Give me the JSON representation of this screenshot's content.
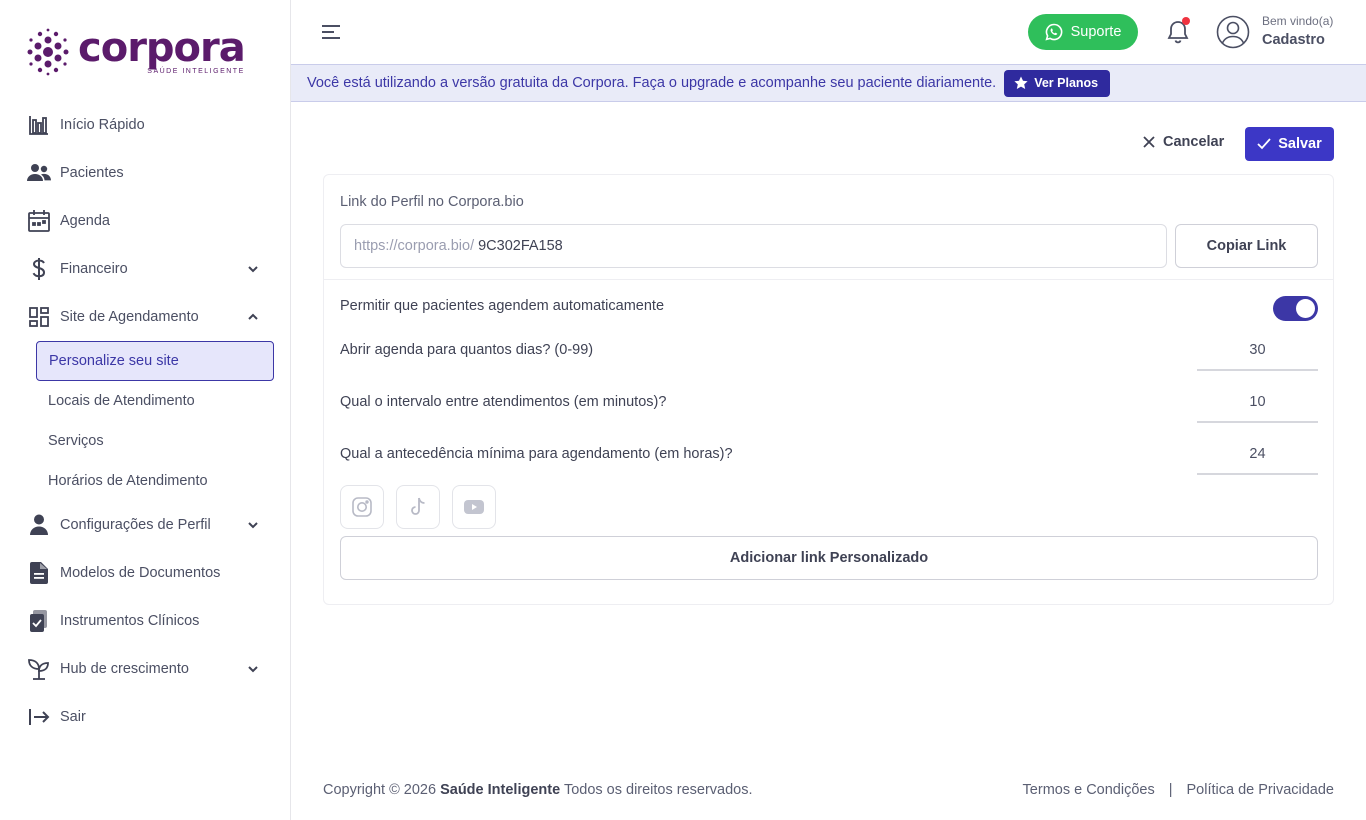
{
  "brand": {
    "name": "corpora",
    "tagline": "SAÚDE INTELIGENTE",
    "color": "#5b1b6b"
  },
  "sidebar": {
    "items": [
      {
        "label": "Início Rápido",
        "icon": "bar-chart-icon"
      },
      {
        "label": "Pacientes",
        "icon": "users-icon"
      },
      {
        "label": "Agenda",
        "icon": "calendar-icon"
      },
      {
        "label": "Financeiro",
        "icon": "dollar-icon",
        "expandable": true,
        "expanded": false
      },
      {
        "label": "Site de Agendamento",
        "icon": "dashboard-grid-icon",
        "expandable": true,
        "expanded": true
      },
      {
        "label": "Configurações de Perfil",
        "icon": "user-icon",
        "expandable": true,
        "expanded": false
      },
      {
        "label": "Modelos de Documentos",
        "icon": "document-icon"
      },
      {
        "label": "Instrumentos Clínicos",
        "icon": "clipboard-check-icon"
      },
      {
        "label": "Hub de crescimento",
        "icon": "sprout-icon",
        "expandable": true,
        "expanded": false
      },
      {
        "label": "Sair",
        "icon": "logout-icon"
      }
    ],
    "site_submenu": [
      {
        "label": "Personalize seu site",
        "active": true
      },
      {
        "label": "Locais de Atendimento",
        "active": false
      },
      {
        "label": "Serviços",
        "active": false
      },
      {
        "label": "Horários de Atendimento",
        "active": false
      }
    ]
  },
  "header": {
    "support_label": "Suporte",
    "welcome": "Bem vindo(a)",
    "user_name": "Cadastro"
  },
  "banner": {
    "text": "Você está utilizando a versão gratuita da Corpora. Faça o upgrade e acompanhe seu paciente diariamente.",
    "button_label": "Ver Planos"
  },
  "actions": {
    "cancel_label": "Cancelar",
    "save_label": "Salvar"
  },
  "form": {
    "link_label": "Link do Perfil no Corpora.bio",
    "link_prefix": "https://corpora.bio/",
    "link_code": "9C302FA158",
    "copy_label": "Copiar Link",
    "auto_schedule_label": "Permitir que pacientes agendem automaticamente",
    "auto_schedule_enabled": true,
    "days_label": "Abrir agenda para quantos dias? (0-99)",
    "days_value": "30",
    "interval_label": "Qual o intervalo entre atendimentos (em minutos)?",
    "interval_value": "10",
    "advance_label": "Qual a antecedência mínima para agendamento (em horas)?",
    "advance_value": "24",
    "socials": [
      "instagram-icon",
      "tiktok-icon",
      "youtube-icon"
    ],
    "add_link_label": "Adicionar link Personalizado"
  },
  "footer": {
    "copyright_prefix": "Copyright © 2026",
    "company": "Saúde Inteligente",
    "rights": "Todos os direitos reservados.",
    "terms": "Termos e Condições",
    "privacy": "Política de Privacidade"
  },
  "colors": {
    "primary": "#3c37c6",
    "support_green": "#2fbf5b",
    "banner_bg": "#e9ebf8",
    "notification_red": "#ef3340"
  }
}
